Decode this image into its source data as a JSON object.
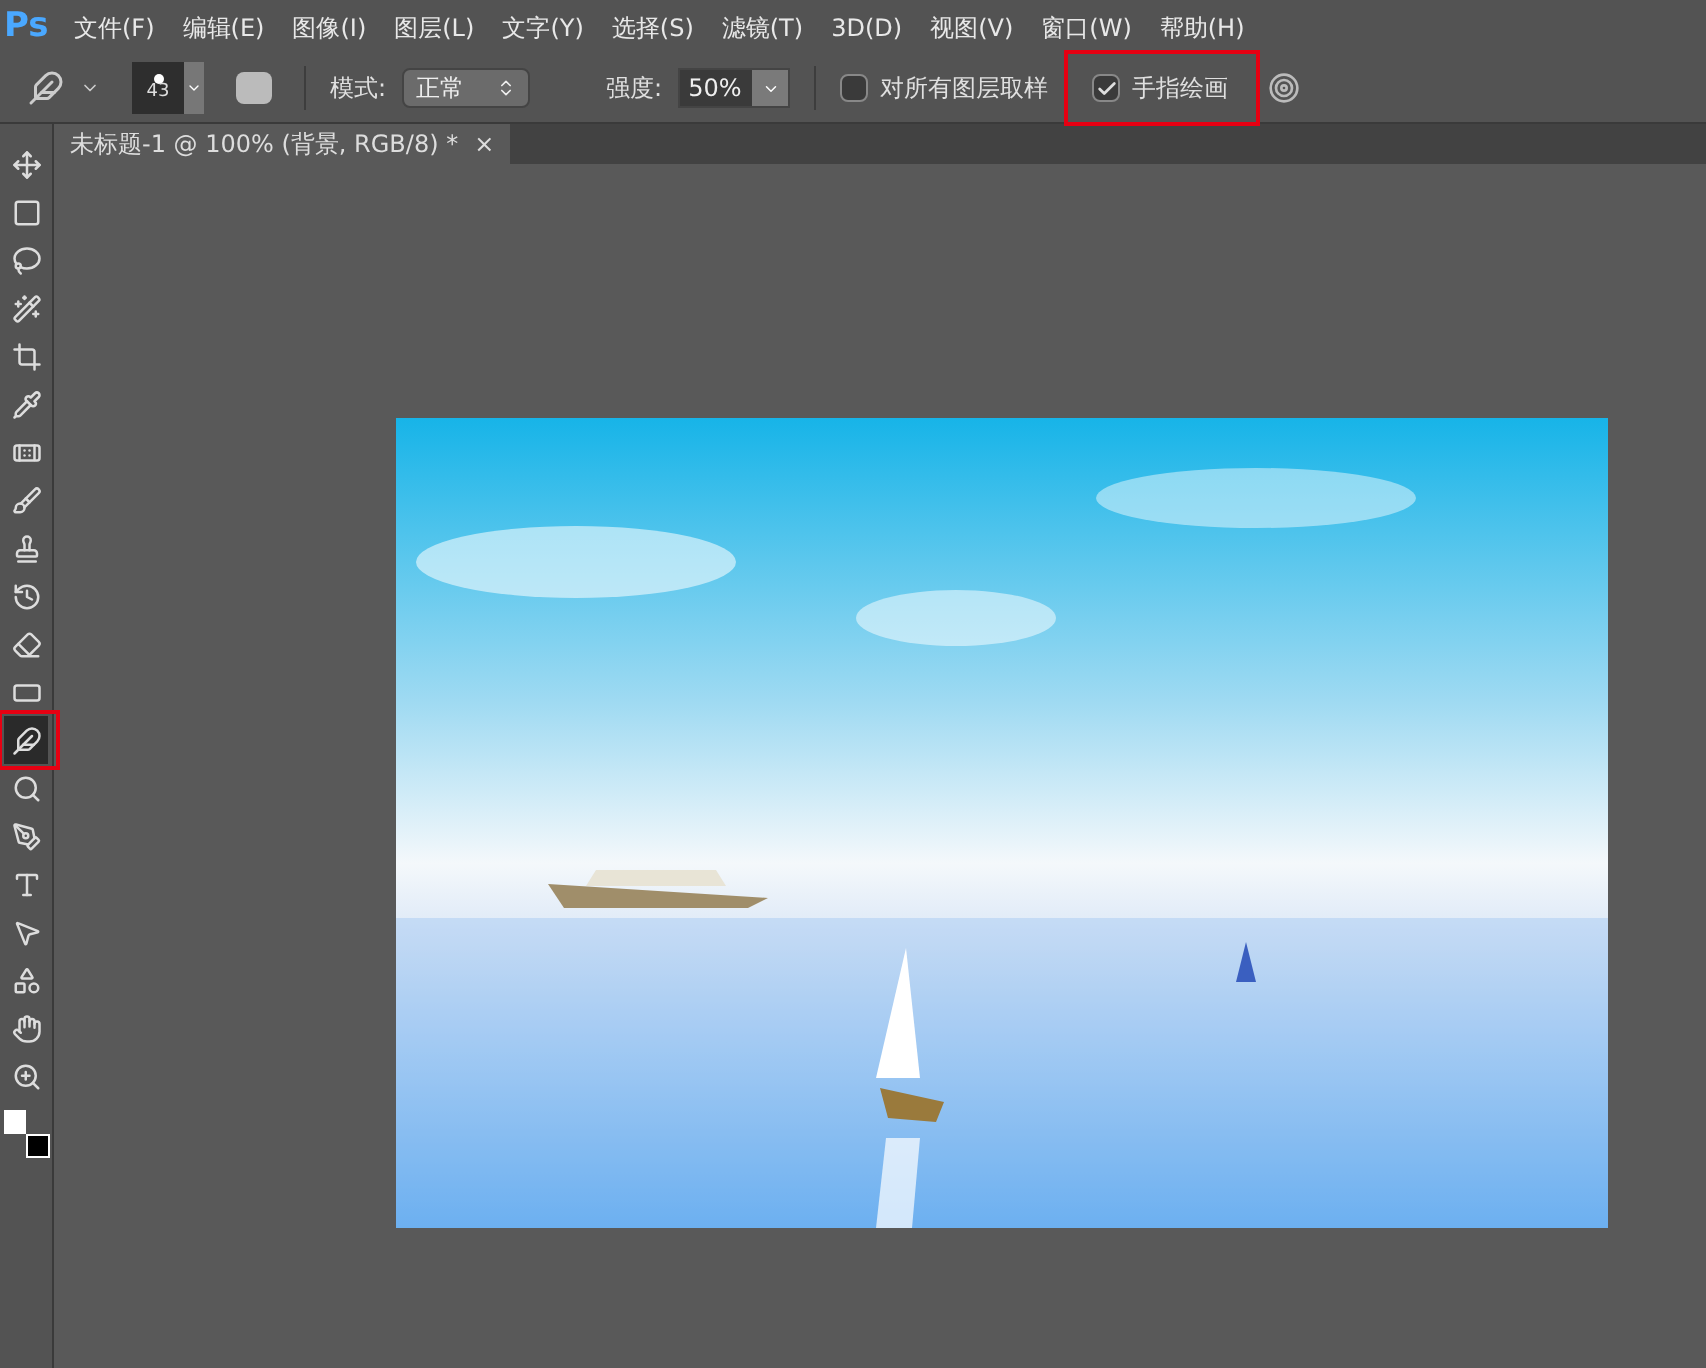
{
  "app": {
    "logo": "Ps"
  },
  "menu": [
    "文件(F)",
    "编辑(E)",
    "图像(I)",
    "图层(L)",
    "文字(Y)",
    "选择(S)",
    "滤镜(T)",
    "3D(D)",
    "视图(V)",
    "窗口(W)",
    "帮助(H)"
  ],
  "options_bar": {
    "brush_size": "43",
    "mode_label": "模式:",
    "mode_value": "正常",
    "strength_label": "强度:",
    "strength_value": "50%",
    "sample_all": {
      "label": "对所有图层取样",
      "checked": false,
      "highlighted": false
    },
    "finger_painting": {
      "label": "手指绘画",
      "checked": true,
      "highlighted": true
    }
  },
  "document_tab": {
    "title": "未标题-1 @ 100% (背景, RGB/8) *",
    "close": "×"
  },
  "tools": [
    {
      "selected": false,
      "highlighted": false
    },
    {
      "selected": false,
      "highlighted": false
    },
    {
      "selected": false,
      "highlighted": false
    },
    {
      "selected": false,
      "highlighted": false
    },
    {
      "selected": false,
      "highlighted": false
    },
    {
      "selected": false,
      "highlighted": false
    },
    {
      "selected": false,
      "highlighted": false
    },
    {
      "selected": false,
      "highlighted": false
    },
    {
      "selected": false,
      "highlighted": false
    },
    {
      "selected": false,
      "highlighted": false
    },
    {
      "selected": false,
      "highlighted": false
    },
    {
      "selected": false,
      "highlighted": false
    },
    {
      "selected": true,
      "highlighted": true
    },
    {
      "selected": false,
      "highlighted": false
    },
    {
      "selected": false,
      "highlighted": false
    },
    {
      "selected": false,
      "highlighted": false
    },
    {
      "selected": false,
      "highlighted": false
    },
    {
      "selected": false,
      "highlighted": false
    },
    {
      "selected": false,
      "highlighted": false
    },
    {
      "selected": false,
      "highlighted": false
    }
  ]
}
